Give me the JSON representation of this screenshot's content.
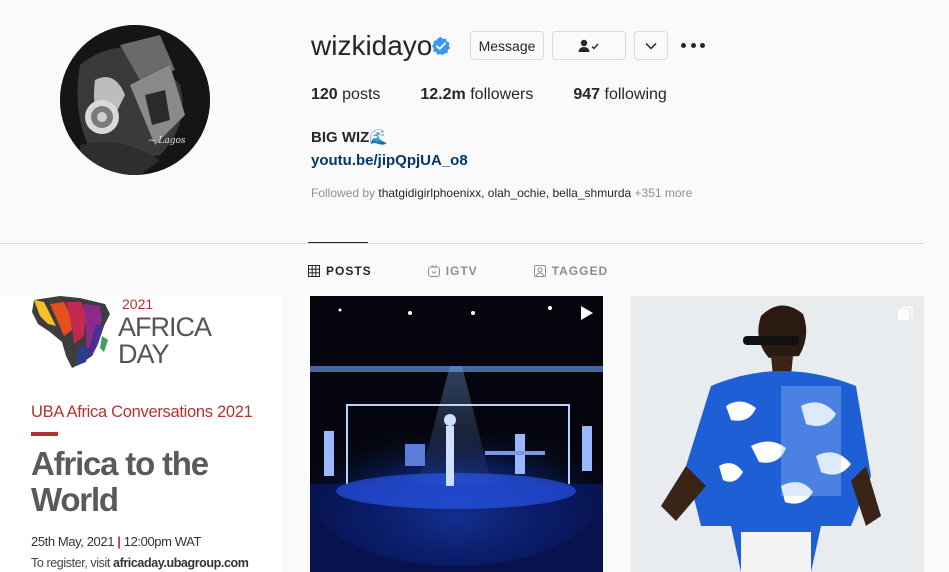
{
  "profile": {
    "username": "wizkidayo",
    "verified": true,
    "message_label": "Message",
    "stats": {
      "posts_count": "120",
      "posts_label": "posts",
      "followers_count": "12.2m",
      "followers_label": "followers",
      "following_count": "947",
      "following_label": "following"
    },
    "bio_name": "BIG WIZ🌊",
    "bio_link": "youtu.be/jipQpjUA_o8",
    "followed_by_prefix": "Followed by ",
    "followed_by_names": "thatgidigirlphoenixx, olah_ochie, bella_shmurda",
    "followed_by_more": " +351 more"
  },
  "tabs": [
    {
      "label": "POSTS",
      "icon": "grid-icon",
      "active": true
    },
    {
      "label": "IGTV",
      "icon": "igtv-icon",
      "active": false
    },
    {
      "label": "TAGGED",
      "icon": "tagged-icon",
      "active": false
    }
  ],
  "posts": [
    {
      "type": "image",
      "year": "2021",
      "title_line1": "AFRICA",
      "title_line2": "DAY",
      "conversations": "UBA Africa Conversations 2021",
      "headline_line1": "Africa to the",
      "headline_line2": "World",
      "date": "25th May, 2021",
      "time": "12:00pm WAT",
      "register_prefix": "To register, visit ",
      "register_url": "africaday.ubagroup.com"
    },
    {
      "type": "video",
      "icon": "play-icon"
    },
    {
      "type": "carousel",
      "icon": "multiple-images-icon"
    }
  ],
  "colors": {
    "link": "#00376b",
    "verified_badge": "#3897f0",
    "accent_red": "#b0342d",
    "divider": "#dbdbdb",
    "muted_text": "#8e8e8e"
  }
}
